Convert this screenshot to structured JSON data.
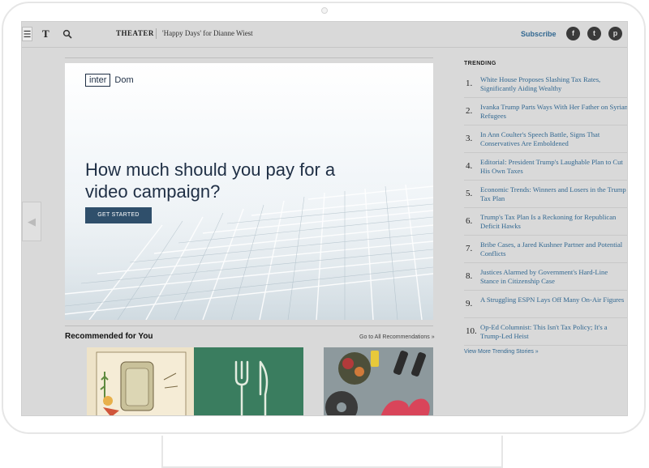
{
  "topbar": {
    "menu_icon": "☰",
    "logo": "T",
    "section": "THEATER",
    "headline": "'Happy Days' for Dianne Wiest",
    "subscribe": "Subscribe",
    "social": {
      "facebook": "f",
      "twitter": "t",
      "pinterest": "p"
    }
  },
  "ad": {
    "brand_box": "inter",
    "brand_rest": "Dom",
    "headline": "How much should you pay for a video campaign?",
    "cta": "GET STARTED"
  },
  "recommended": {
    "title": "Recommended for You",
    "link": "Go to All Recommendations »"
  },
  "trending": {
    "heading": "TRENDING",
    "items": [
      {
        "num": "1.",
        "text": "White House Proposes Slashing Tax Rates, Significantly Aiding Wealthy"
      },
      {
        "num": "2.",
        "text": "Ivanka Trump Parts Ways With Her Father on Syrian Refugees"
      },
      {
        "num": "3.",
        "text": "In Ann Coulter's Speech Battle, Signs That Conservatives Are Emboldened"
      },
      {
        "num": "4.",
        "text": "Editorial: President Trump's Laughable Plan to Cut His Own Taxes"
      },
      {
        "num": "5.",
        "text": "Economic Trends: Winners and Losers in the Trump Tax Plan"
      },
      {
        "num": "6.",
        "text": "Trump's Tax Plan Is a Reckoning for Republican Deficit Hawks"
      },
      {
        "num": "7.",
        "text": "Bribe Cases, a Jared Kushner Partner and Potential Conflicts"
      },
      {
        "num": "8.",
        "text": "Justices Alarmed by Government's Hard-Line Stance in Citizenship Case"
      },
      {
        "num": "9.",
        "text": "A Struggling ESPN Lays Off Many On-Air Figures"
      },
      {
        "num": "10.",
        "text": "Op-Ed Columnist: This Isn't Tax Policy; It's a Trump-Led Heist"
      }
    ],
    "more": "View More Trending Stories »"
  },
  "colors": {
    "overlay": "#d9d9d9",
    "link": "#326891",
    "cta": "#2f4f6b",
    "ad_text": "#1f2f45"
  }
}
